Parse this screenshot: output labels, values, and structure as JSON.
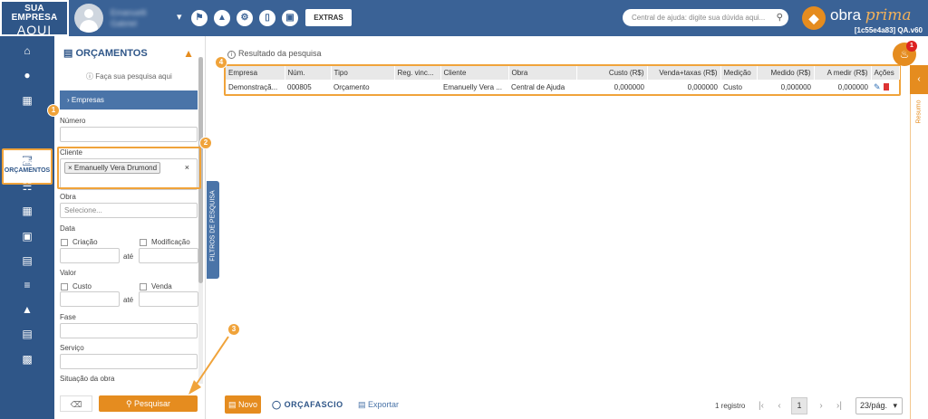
{
  "header": {
    "brand_line1": "SUA EMPRESA",
    "brand_line2": "AQUI",
    "user_first": "Emanuelli",
    "user_last": "Gabriel",
    "extras_label": "EXTRAS",
    "help_placeholder": "Central de ajuda: digite sua dúvida aqui...",
    "logo_obra": "obra",
    "logo_prima": "prima",
    "version": "[1c55e4a83] QA.v60"
  },
  "rail": {
    "active_label": "ORÇAMENTOS"
  },
  "panel": {
    "title": "ORÇAMENTOS",
    "hint": "Faça sua pesquisa aqui",
    "accordion_label": "Empresas",
    "numero_label": "Número",
    "cliente_label": "Cliente",
    "cliente_chip": "Emanuelly Vera Drumond",
    "obra_label": "Obra",
    "obra_placeholder": "Selecione...",
    "data_label": "Data",
    "criacao_label": "Criação",
    "modificacao_label": "Modificação",
    "ate_label": "até",
    "valor_label": "Valor",
    "custo_label": "Custo",
    "venda_label": "Venda",
    "fase_label": "Fase",
    "servico_label": "Serviço",
    "situacao_label": "Situação da obra",
    "search_label": "Pesquisar",
    "collapse_label": "FILTROS DE PESQUISA"
  },
  "results": {
    "header": "Resultado da pesquisa",
    "columns": [
      "Empresa",
      "Núm.",
      "Tipo",
      "Reg. vinc...",
      "Cliente",
      "Obra",
      "Custo (R$)",
      "Venda+taxas (R$)",
      "Medição",
      "Medido (R$)",
      "A medir (R$)",
      "Ações"
    ],
    "rows": [
      [
        "Demonstraçã...",
        "000805",
        "Orçamento",
        "",
        "Emanuelly Vera ...",
        "Central de Ajuda",
        "0,000000",
        "0,000000",
        "Custo",
        "0,000000",
        "0,000000"
      ]
    ]
  },
  "notifications": {
    "count": "1"
  },
  "resumo": {
    "label": "Resumo"
  },
  "footer": {
    "novo_label": "Novo",
    "orcafascio_label": "ORÇAFASCIO",
    "exportar_label": "Exportar",
    "record_count": "1 registro",
    "current_page": "1",
    "per_page": "23/pág."
  },
  "annotations": [
    "1",
    "2",
    "3",
    "4"
  ],
  "colors": {
    "primary": "#3a6296",
    "accent": "#e58c1f",
    "highlight": "#f0a33a"
  }
}
